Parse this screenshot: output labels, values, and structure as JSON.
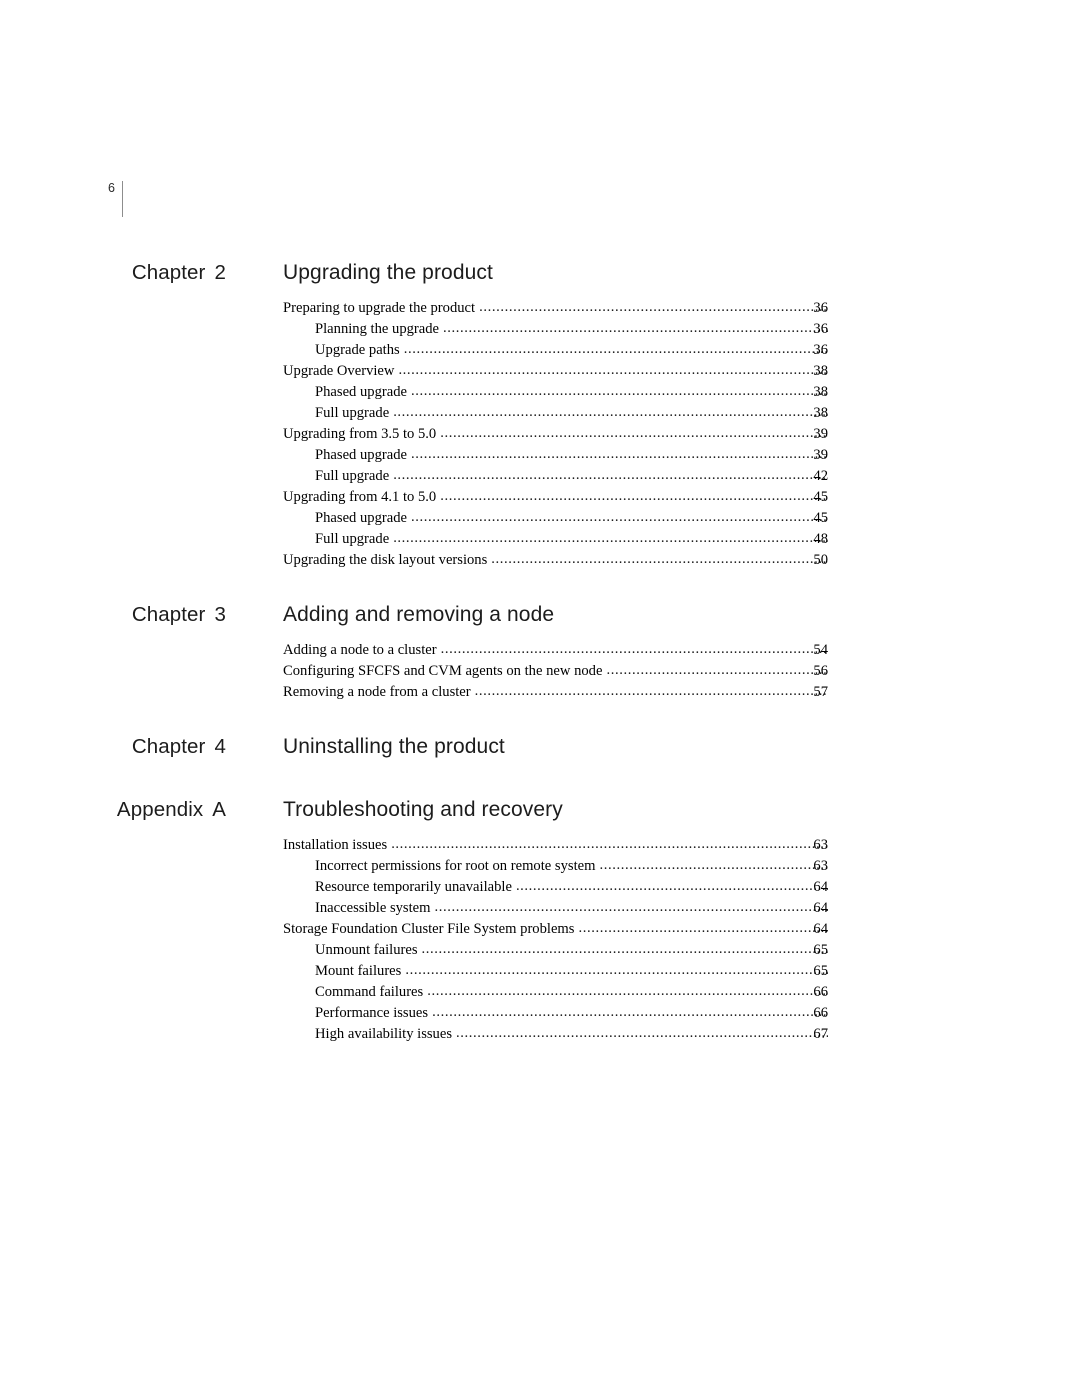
{
  "page": {
    "folio_number": "6",
    "document_type": "table-of-contents"
  },
  "toc": {
    "groups": [
      {
        "label": "Chapter",
        "number": "2",
        "title": "Upgrading the product",
        "entries": [
          {
            "text": "Preparing to upgrade the product",
            "page": "36",
            "level": 1
          },
          {
            "text": "Planning the upgrade",
            "page": "36",
            "level": 2
          },
          {
            "text": "Upgrade paths",
            "page": "36",
            "level": 2
          },
          {
            "text": "Upgrade Overview",
            "page": "38",
            "level": 1
          },
          {
            "text": "Phased upgrade",
            "page": "38",
            "level": 2
          },
          {
            "text": "Full upgrade",
            "page": "38",
            "level": 2
          },
          {
            "text": "Upgrading from 3.5 to 5.0",
            "page": "39",
            "level": 1
          },
          {
            "text": "Phased upgrade",
            "page": "39",
            "level": 2
          },
          {
            "text": "Full upgrade",
            "page": "42",
            "level": 2
          },
          {
            "text": "Upgrading from 4.1 to 5.0",
            "page": "45",
            "level": 1
          },
          {
            "text": "Phased upgrade",
            "page": "45",
            "level": 2
          },
          {
            "text": "Full upgrade",
            "page": "48",
            "level": 2
          },
          {
            "text": "Upgrading the disk layout versions",
            "page": "50",
            "level": 1
          }
        ]
      },
      {
        "label": "Chapter",
        "number": "3",
        "title": "Adding and removing a node",
        "entries": [
          {
            "text": "Adding a node to a cluster",
            "page": "54",
            "level": 1
          },
          {
            "text": "Configuring SFCFS and CVM agents on the new node",
            "page": "56",
            "level": 1
          },
          {
            "text": "Removing a node from a cluster",
            "page": "57",
            "level": 1
          }
        ]
      },
      {
        "label": "Chapter",
        "number": "4",
        "title": "Uninstalling the product",
        "entries": []
      },
      {
        "label": "Appendix",
        "number": "A",
        "title": "Troubleshooting and recovery",
        "entries": [
          {
            "text": "Installation issues",
            "page": "63",
            "level": 1
          },
          {
            "text": "Incorrect permissions for root on remote system",
            "page": "63",
            "level": 2
          },
          {
            "text": "Resource temporarily unavailable",
            "page": "64",
            "level": 2
          },
          {
            "text": "Inaccessible system",
            "page": "64",
            "level": 2
          },
          {
            "text": "Storage Foundation Cluster File System problems",
            "page": "64",
            "level": 1
          },
          {
            "text": "Unmount failures",
            "page": "65",
            "level": 2
          },
          {
            "text": "Mount failures",
            "page": "65",
            "level": 2
          },
          {
            "text": "Command failures",
            "page": "66",
            "level": 2
          },
          {
            "text": "Performance issues",
            "page": "66",
            "level": 2
          },
          {
            "text": "High availability issues",
            "page": "67",
            "level": 2
          }
        ]
      }
    ]
  }
}
